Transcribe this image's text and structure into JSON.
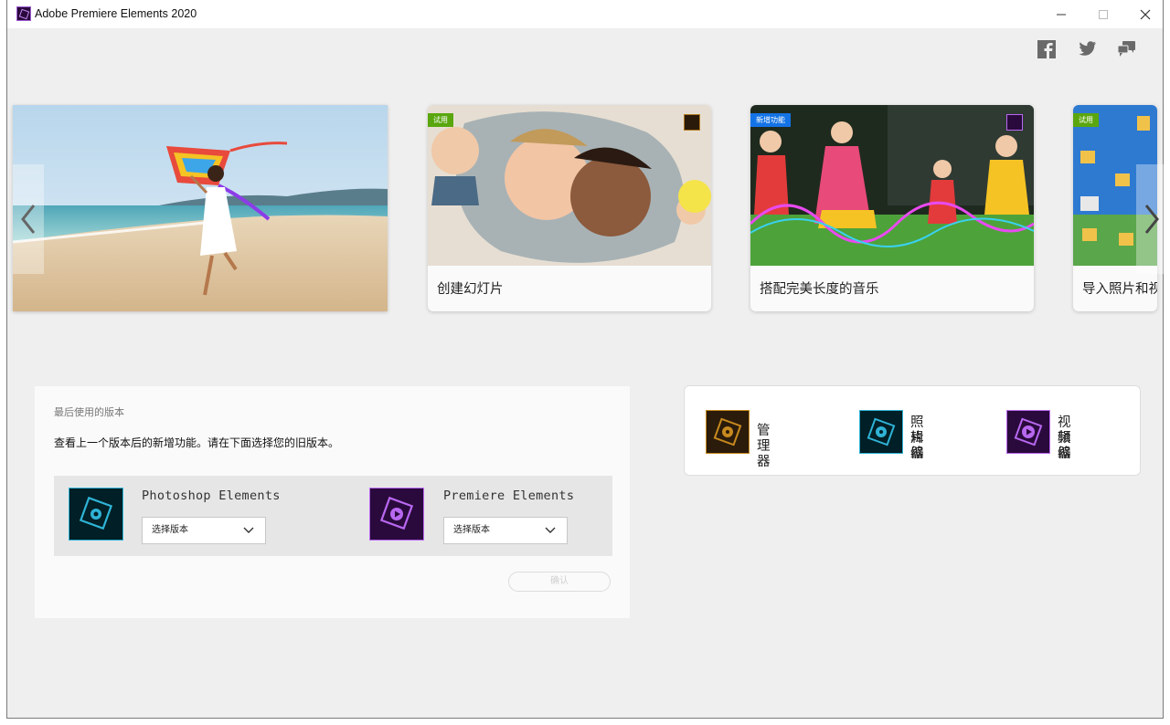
{
  "window": {
    "title": "Adobe Premiere Elements 2020"
  },
  "carousel": {
    "cards": [
      {
        "label": "创建幻灯片",
        "badge": "试用"
      },
      {
        "label": "搭配完美长度的音乐",
        "badge": "新增功能"
      },
      {
        "label": "导入照片和视",
        "badge": "试用"
      }
    ]
  },
  "recent": {
    "title": "最后使用的版本",
    "description": "查看上一个版本后的新增功能。请在下面选择您的旧版本。",
    "products": [
      {
        "name": "Photoshop Elements",
        "select": "选择版本"
      },
      {
        "name": "Premiere Elements",
        "select": "选择版本"
      }
    ],
    "confirm": "确认"
  },
  "launcher": {
    "items": [
      {
        "line1": "管理器",
        "line2": ""
      },
      {
        "line1": "照片编",
        "line2": "辑器"
      },
      {
        "line1": "视频编",
        "line2": "辑器"
      }
    ]
  },
  "colors": {
    "photoshop": "#2fb3d6",
    "premiere": "#b868f0",
    "organizer": "#c78a1f",
    "badge_green": "#5aa60e",
    "badge_blue": "#1473e6"
  },
  "icons": [
    "facebook-icon",
    "twitter-icon",
    "feedback-icon",
    "chevron-left-icon",
    "chevron-right-icon",
    "chevron-down-icon"
  ]
}
